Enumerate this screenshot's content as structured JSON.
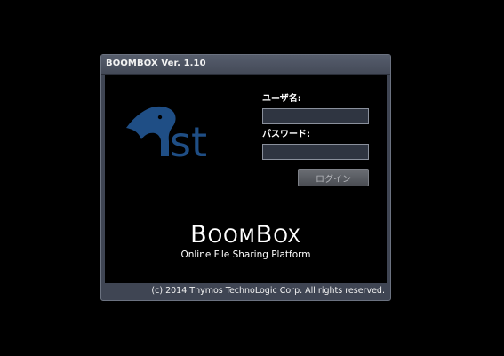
{
  "window": {
    "title": "BOOMBOX Ver. 1.10"
  },
  "logo": {
    "icon": "bird-st-logo-icon",
    "text": "st",
    "color": "#1f4e85"
  },
  "login": {
    "username_label": "ユーザ名:",
    "username_value": "",
    "password_label": "パスワード:",
    "password_value": "",
    "button_label": "ログイン"
  },
  "brand": {
    "name_parts": [
      "B",
      "OOM",
      "B",
      "OX"
    ],
    "tagline": "Online File Sharing Platform"
  },
  "footer": {
    "copyright": "(c) 2014 Thymos TechnoLogic Corp. All rights reserved."
  }
}
